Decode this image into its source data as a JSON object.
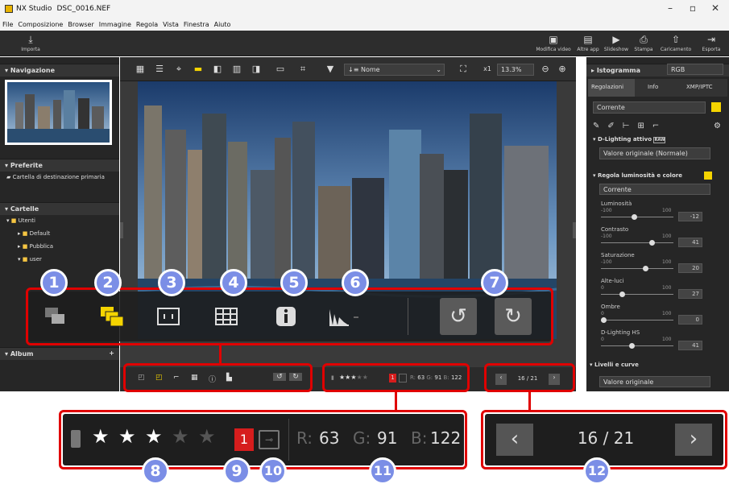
{
  "window": {
    "app": "NX Studio",
    "file": "DSC_0016.NEF"
  },
  "menu": [
    "File",
    "Composizione",
    "Browser",
    "Immagine",
    "Regola",
    "Vista",
    "Finestra",
    "Aiuto"
  ],
  "toolbar": {
    "import": "Importa",
    "modifica": "Modifica video",
    "altre": "Altre app",
    "slideshow": "Slideshow",
    "stampa": "Stampa",
    "caricamento": "Caricamento",
    "esporta": "Esporta"
  },
  "left": {
    "navigazione": "Navigazione",
    "preferite": "Preferite",
    "fav_item": "Cartella di destinazione primaria",
    "cartelle": "Cartelle",
    "tree": [
      "Utenti",
      "Default",
      "Pubblica",
      "user"
    ],
    "album": "Album",
    "album_add": "+"
  },
  "center": {
    "sort": "Nome",
    "sort_icon": "↓≡",
    "zoom_x": "x1",
    "zoom_pct": "13.3%"
  },
  "right": {
    "istogramma": "Istogramma",
    "channel": "RGB",
    "tabs": [
      "Regolazioni",
      "Info",
      "XMP/IPTC"
    ],
    "preset": "Corrente",
    "dlighting_title": "D-Lighting attivo",
    "raw_badge": "RAW",
    "dlighting_value": "Valore originale (Normale)",
    "lum_title": "Regola luminosità e colore",
    "lum_preset": "Corrente",
    "sliders": [
      {
        "label": "Luminosità",
        "min": "-100",
        "max": "100",
        "value": "-12",
        "pos": 0.44
      },
      {
        "label": "Contrasto",
        "min": "-100",
        "max": "100",
        "value": "41",
        "pos": 0.7
      },
      {
        "label": "Saturazione",
        "min": "-100",
        "max": "100",
        "value": "20",
        "pos": 0.6
      },
      {
        "label": "Alte-luci",
        "min": "0",
        "max": "100",
        "value": "27",
        "pos": 0.27
      },
      {
        "label": "Ombre",
        "min": "0",
        "max": "100",
        "value": "0",
        "pos": 0.0
      },
      {
        "label": "D-Lighting HS",
        "min": "0",
        "max": "100",
        "value": "41",
        "pos": 0.41
      }
    ],
    "livelli": "Livelli e curve",
    "livelli_value": "Valore originale"
  },
  "statusbar": {
    "rating": 3,
    "max_rating": 5,
    "label_number": "1",
    "r": "63",
    "g": "91",
    "b": "122",
    "r_label": "R:",
    "g_label": "G:",
    "b_label": "B:",
    "page": "16 / 21"
  },
  "callouts": [
    "1",
    "2",
    "3",
    "4",
    "5",
    "6",
    "7",
    "8",
    "9",
    "10",
    "11",
    "12"
  ],
  "colors": {
    "callout": "#7b8ee6",
    "highlight": "#e00000",
    "yellow": "#f5d400"
  }
}
